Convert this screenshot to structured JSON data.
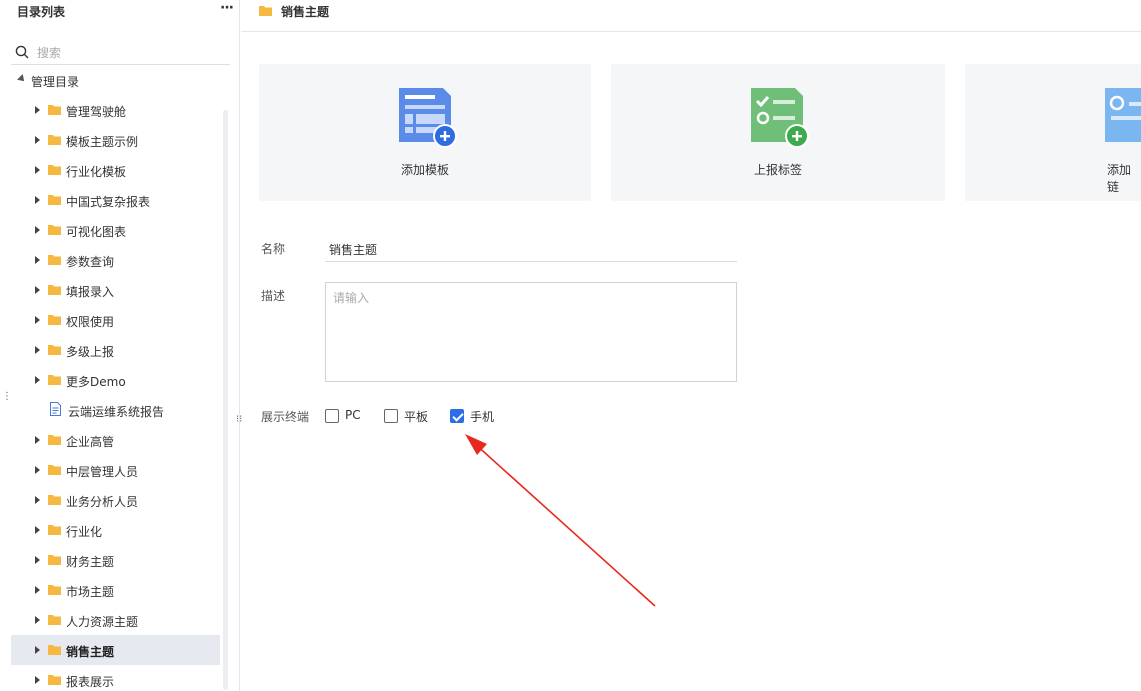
{
  "sidebar": {
    "title": "目录列表",
    "more": "···",
    "search_placeholder": "搜索",
    "root_label": "管理目录",
    "items": [
      {
        "label": "管理驾驶舱",
        "type": "folder"
      },
      {
        "label": "模板主题示例",
        "type": "folder"
      },
      {
        "label": "行业化模板",
        "type": "folder"
      },
      {
        "label": "中国式复杂报表",
        "type": "folder"
      },
      {
        "label": "可视化图表",
        "type": "folder"
      },
      {
        "label": "参数查询",
        "type": "folder"
      },
      {
        "label": "填报录入",
        "type": "folder"
      },
      {
        "label": "权限使用",
        "type": "folder"
      },
      {
        "label": "多级上报",
        "type": "folder"
      },
      {
        "label": "更多Demo",
        "type": "folder"
      },
      {
        "label": "云端运维系统报告",
        "type": "doc"
      },
      {
        "label": "企业高管",
        "type": "folder"
      },
      {
        "label": "中层管理人员",
        "type": "folder"
      },
      {
        "label": "业务分析人员",
        "type": "folder"
      },
      {
        "label": "行业化",
        "type": "folder"
      },
      {
        "label": "财务主题",
        "type": "folder"
      },
      {
        "label": "市场主题",
        "type": "folder"
      },
      {
        "label": "人力资源主题",
        "type": "folder"
      },
      {
        "label": "销售主题",
        "type": "folder",
        "selected": true
      },
      {
        "label": "报表展示",
        "type": "folder"
      }
    ]
  },
  "main": {
    "title": "销售主题",
    "cards": [
      {
        "label": "添加模板",
        "icon": "add-template-icon"
      },
      {
        "label": "上报标签",
        "icon": "report-tag-icon"
      },
      {
        "label": "添加链",
        "icon": "add-link-icon"
      }
    ],
    "form": {
      "name_label": "名称",
      "name_value": "销售主题",
      "desc_label": "描述",
      "desc_placeholder": "请输入",
      "terminal_label": "展示终端",
      "options": [
        {
          "label": "PC",
          "checked": false
        },
        {
          "label": "平板",
          "checked": false
        },
        {
          "label": "手机",
          "checked": true
        }
      ]
    }
  },
  "colors": {
    "accent": "#2a6ee8",
    "folder": "#f5b942",
    "selected_bg": "#e6e9f0",
    "card_bg": "#f5f6f8",
    "annotation_arrow": "#e8291f"
  }
}
